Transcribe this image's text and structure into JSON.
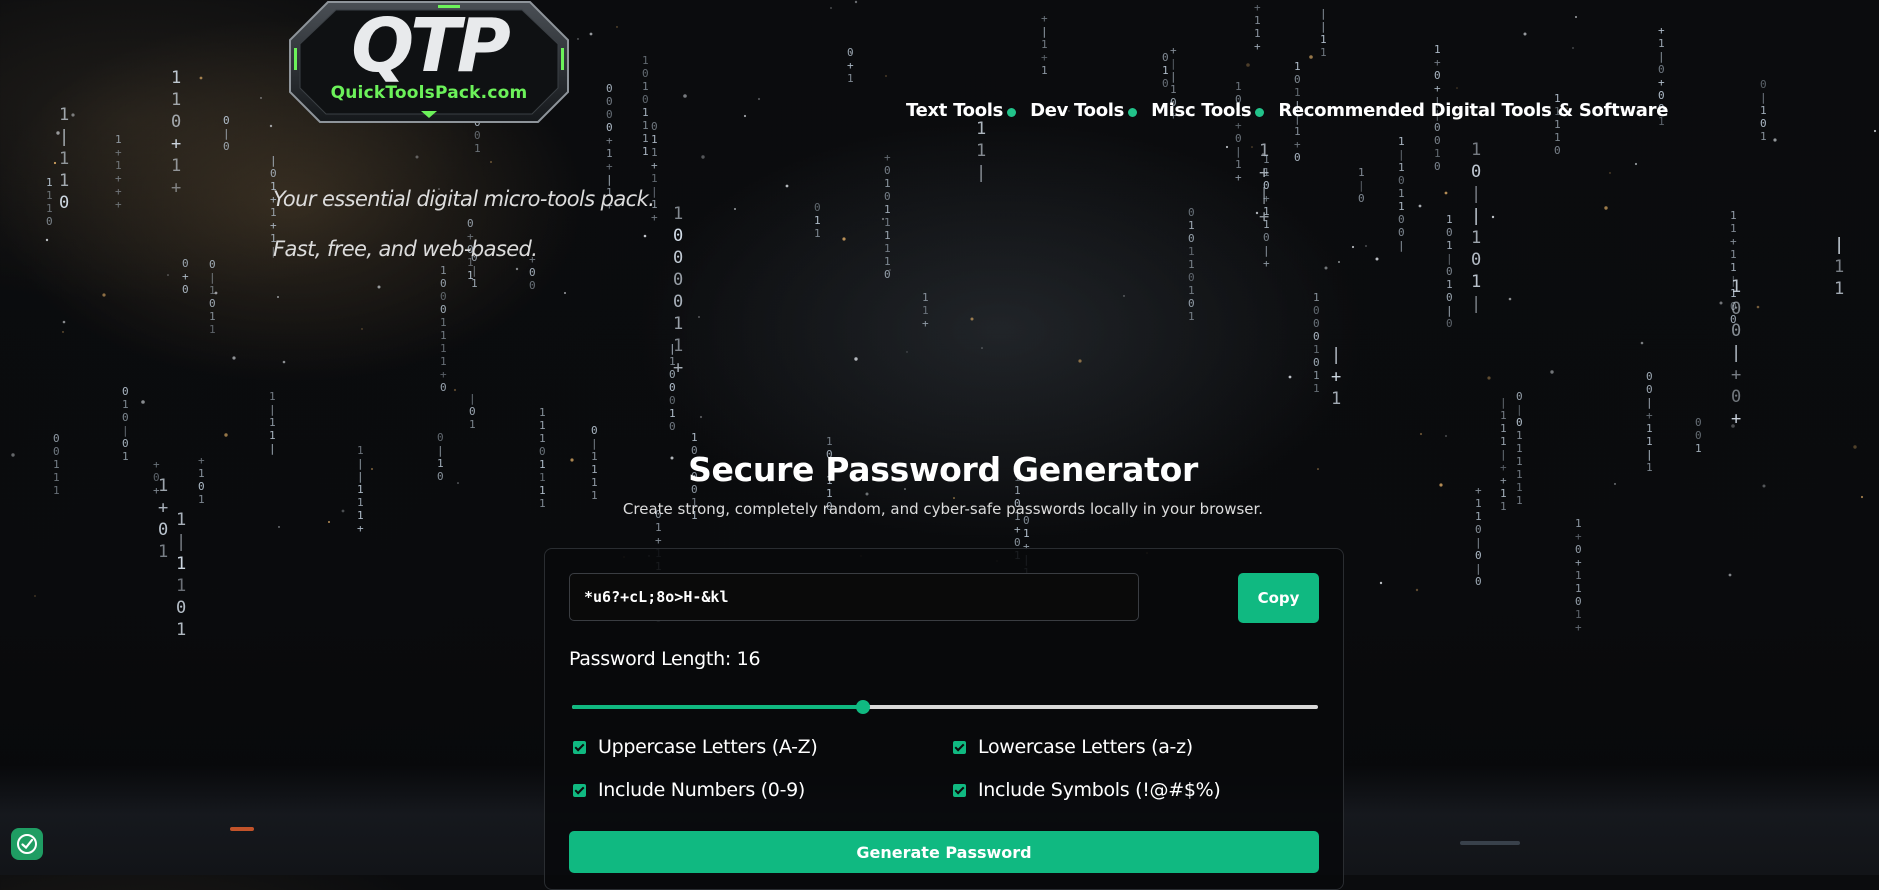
{
  "brand": {
    "logo_letters": "QTP",
    "site_name": "QuickToolsPack.com"
  },
  "nav": {
    "items": [
      {
        "label": "Text Tools",
        "has_dot": true
      },
      {
        "label": "Dev Tools",
        "has_dot": true
      },
      {
        "label": "Misc Tools",
        "has_dot": true
      },
      {
        "label": "Recommended Digital Tools & Software",
        "has_dot": false
      }
    ]
  },
  "tagline": {
    "line1": "Your essential digital micro-tools pack.",
    "line2": "Fast, free, and web-based."
  },
  "main": {
    "title": "Secure Password Generator",
    "subtitle": "Create strong, completely random, and cyber-safe passwords locally in your browser."
  },
  "generator": {
    "password_value": "*u6?+cL;8o>H-&kl",
    "copy_label": "Copy",
    "length_label": "Password Length: 16",
    "length_value": 16,
    "length_fraction": 0.39,
    "options": [
      {
        "label": "Uppercase Letters (A-Z)",
        "checked": true
      },
      {
        "label": "Lowercase Letters (a-z)",
        "checked": true
      },
      {
        "label": "Include Numbers (0-9)",
        "checked": true
      },
      {
        "label": "Include Symbols (!@#$%)",
        "checked": true
      }
    ],
    "generate_label": "Generate Password"
  },
  "colors": {
    "accent": "#10b981",
    "logo_green": "#6cf25a",
    "background": "#0a0b0d"
  },
  "icons": {
    "corner_badge": "shield-check-icon",
    "nav_dot": "green-dot-icon"
  }
}
